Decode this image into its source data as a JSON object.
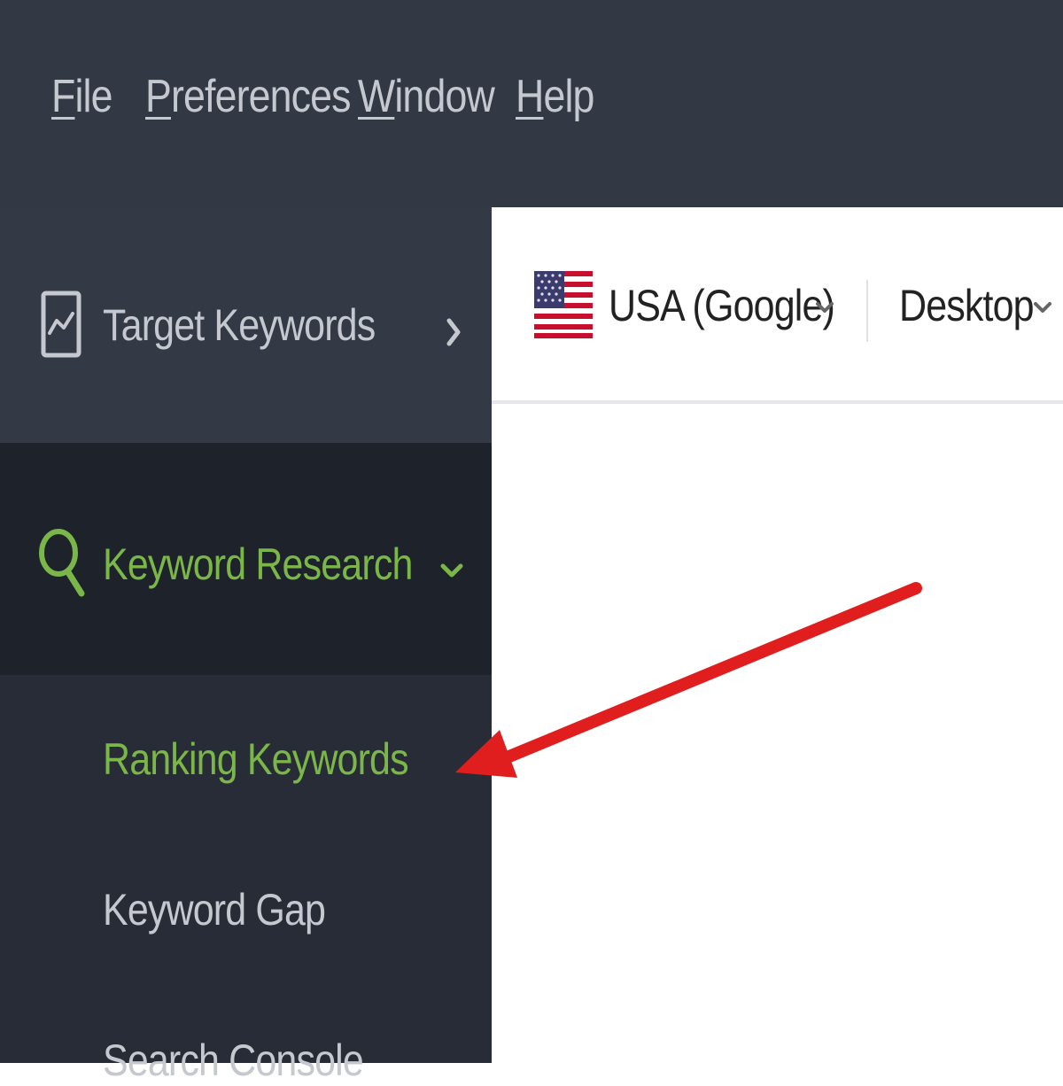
{
  "menubar": {
    "items": [
      {
        "mnemonic": "F",
        "rest": "ile"
      },
      {
        "mnemonic": "P",
        "rest": "references"
      },
      {
        "mnemonic": "W",
        "rest": "indow"
      },
      {
        "mnemonic": "H",
        "rest": "elp"
      }
    ]
  },
  "sidebar": {
    "target_keywords": "Target Keywords",
    "keyword_research": "Keyword Research",
    "sub_items": [
      "Ranking Keywords",
      "Keyword Gap",
      "Search Console"
    ]
  },
  "toolbar": {
    "country": "USA (Google)",
    "device": "Desktop"
  },
  "colors": {
    "menubar_bg": "#333845",
    "sidebar_bg": "#282c37",
    "active_green": "#7ab648",
    "arrow_red": "#e01e1e"
  },
  "icons": [
    "chart-icon",
    "chevron-right-icon",
    "search-icon",
    "chevron-down-icon",
    "us-flag-icon"
  ]
}
